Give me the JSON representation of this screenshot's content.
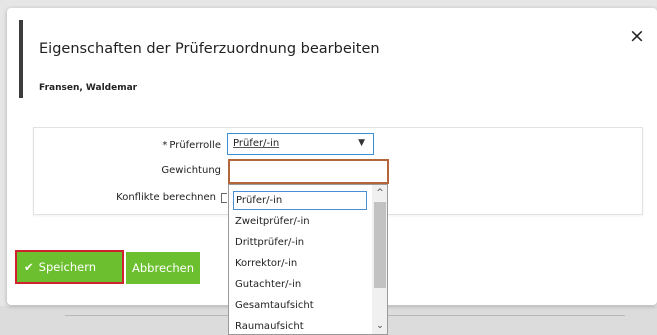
{
  "dialog": {
    "title": "Eigenschaften der Prüferzuordnung bearbeiten",
    "subtitle": "Fransen, Waldemar",
    "close_icon": "×"
  },
  "form": {
    "role_required_marker": "*",
    "role_label": "Prüferrolle",
    "role_value": "Prüfer/-in",
    "weight_label": "Gewichtung",
    "weight_value": "",
    "conflicts_label": "Konflikte berechnen"
  },
  "dropdown": {
    "options": [
      "Prüfer/-in",
      "Zweitprüfer/-in",
      "Drittprüfer/-in",
      "Korrektor/-in",
      "Gutachter/-in",
      "Gesamtaufsicht",
      "Raumaufsicht"
    ],
    "selected": "Prüfer/-in",
    "scroll_up_icon": "^",
    "scroll_down_icon": "⌄"
  },
  "buttons": {
    "save_label": "Speichern",
    "save_icon": "✔",
    "cancel_label": "Abbrechen"
  },
  "colors": {
    "accent_green": "#6cbf2f",
    "focus_red": "#d0222c",
    "select_blue": "#3d8fd4",
    "input_orange": "#b5653a"
  }
}
